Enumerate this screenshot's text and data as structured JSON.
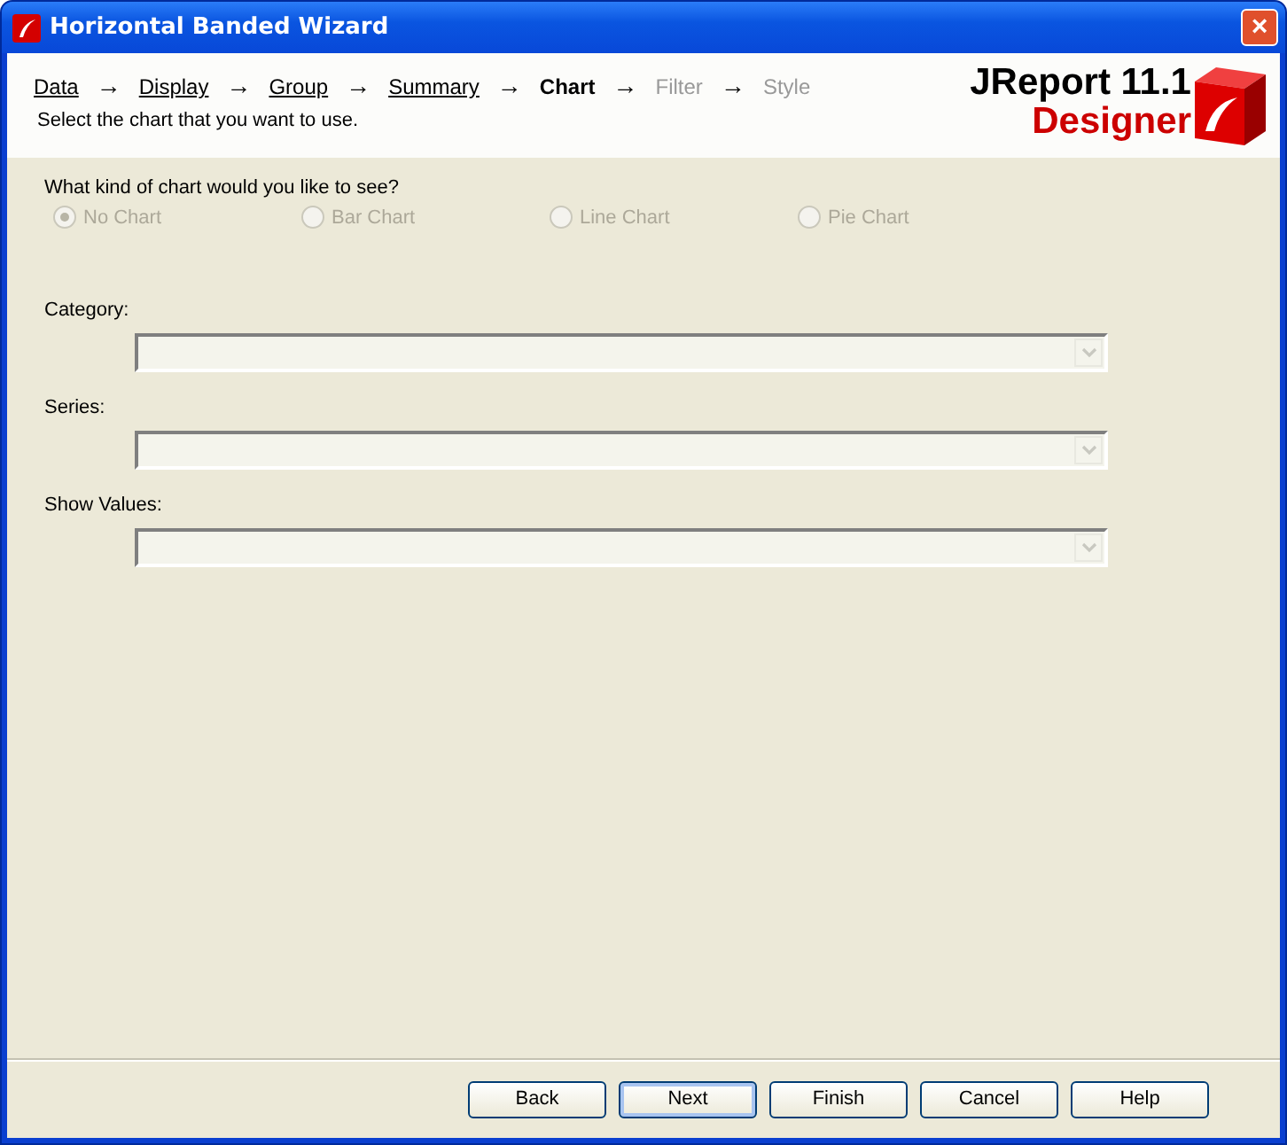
{
  "window": {
    "title": "Horizontal Banded Wizard",
    "close": "×"
  },
  "steps": [
    {
      "label": "Data",
      "kind": "done",
      "arrow": "→"
    },
    {
      "label": "Display",
      "kind": "done",
      "arrow": "→"
    },
    {
      "label": "Group",
      "kind": "done",
      "arrow": "→"
    },
    {
      "label": "Summary",
      "kind": "done",
      "arrow": "→"
    },
    {
      "label": "Chart",
      "kind": "current",
      "arrow": "→"
    },
    {
      "label": "Filter",
      "kind": "future",
      "arrow": "→"
    },
    {
      "label": "Style",
      "kind": "future"
    }
  ],
  "subtitle": "Select the chart that you want to use.",
  "logo": {
    "product": "JReport 11.1",
    "edition": "Designer"
  },
  "question": "What kind of chart would you like to see?",
  "chart_types": [
    {
      "label": "No Chart",
      "selected": true,
      "disabled": true
    },
    {
      "label": "Bar Chart",
      "selected": false,
      "disabled": true
    },
    {
      "label": "Line Chart",
      "selected": false,
      "disabled": true
    },
    {
      "label": "Pie Chart",
      "selected": false,
      "disabled": true
    }
  ],
  "fields": [
    {
      "label": "Category:",
      "disabled": true
    },
    {
      "label": "Series:",
      "disabled": true
    },
    {
      "label": "Show Values:",
      "disabled": true
    }
  ],
  "buttons": [
    {
      "label": "Back",
      "default": false
    },
    {
      "label": "Next",
      "default": true
    },
    {
      "label": "Finish",
      "default": false
    },
    {
      "label": "Cancel",
      "default": false
    },
    {
      "label": "Help",
      "default": false
    }
  ]
}
